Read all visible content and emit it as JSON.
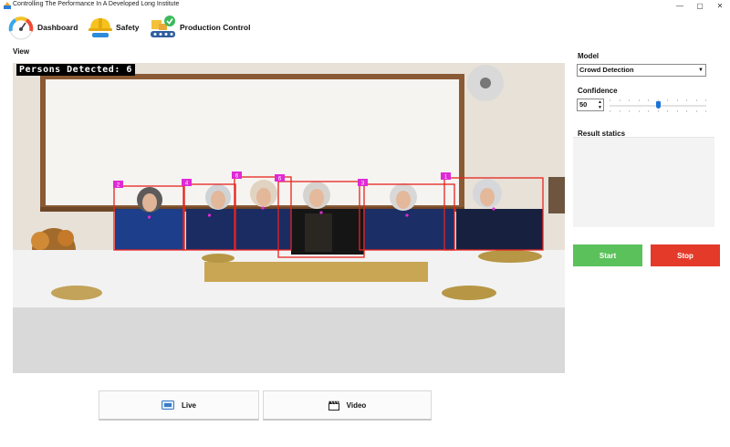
{
  "window": {
    "title": "Controlling The Performance In A Developed Long Institute",
    "controls": {
      "minimize": "—",
      "maximize": "▢",
      "close": "✕"
    }
  },
  "toolbar": {
    "items": [
      {
        "label": "Dashboard",
        "icon": "speedometer-icon"
      },
      {
        "label": "Safety",
        "icon": "safety-helmet-icon"
      },
      {
        "label": "Production Control",
        "icon": "production-conveyor-icon"
      }
    ]
  },
  "view": {
    "label": "View",
    "overlay_text": "Persons Detected: 6",
    "box_color": "#e8231f",
    "label_color": "#e02ad6",
    "detection_ids": [
      "2",
      "4",
      "6",
      "6",
      "3",
      "1"
    ]
  },
  "sources": {
    "live_label": "Live",
    "video_label": "Video"
  },
  "settings": {
    "model_label": "Model",
    "model_value": "Crowd Detection",
    "confidence_label": "Confidence",
    "confidence_value": "50",
    "confidence_fraction": 0.5,
    "results_label": "Result statics"
  },
  "actions": {
    "start_label": "Start",
    "stop_label": "Stop",
    "start_color": "#5bc25b",
    "stop_color": "#e43a2a"
  }
}
